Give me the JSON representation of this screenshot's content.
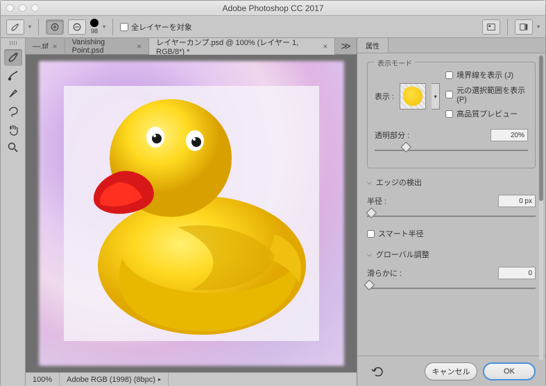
{
  "app": {
    "title": "Adobe Photoshop CC 2017"
  },
  "options": {
    "brush_size": "98",
    "all_layers_label": "全レイヤーを対象"
  },
  "tabs": {
    "items": [
      {
        "label": "—.tif"
      },
      {
        "label": "Vanishing Point.psd"
      },
      {
        "label": "レイヤーカンプ.psd @ 100% (レイヤー 1, RGB/8*) *",
        "active": true
      }
    ],
    "more": "≫"
  },
  "statusbar": {
    "zoom": "100%",
    "profile": "Adobe RGB (1998) (8bpc)"
  },
  "panel": {
    "title": "属性",
    "display_mode": {
      "legend": "表示モード",
      "show_label": "表示 :",
      "show_border": "境界線を表示 (J)",
      "show_original": "元の選択範囲を表示 (P)",
      "high_quality": "高品質プレビュー"
    },
    "transparency": {
      "label": "透明部分 :",
      "value": "20%"
    },
    "edge": {
      "title": "エッジの検出",
      "radius_label": "半径 :",
      "radius_value": "0 px",
      "smart_radius": "スマート半径"
    },
    "global": {
      "title": "グローバル調整",
      "smooth_label": "滑らかに :",
      "smooth_value": "0"
    },
    "buttons": {
      "cancel": "キャンセル",
      "ok": "OK"
    }
  }
}
